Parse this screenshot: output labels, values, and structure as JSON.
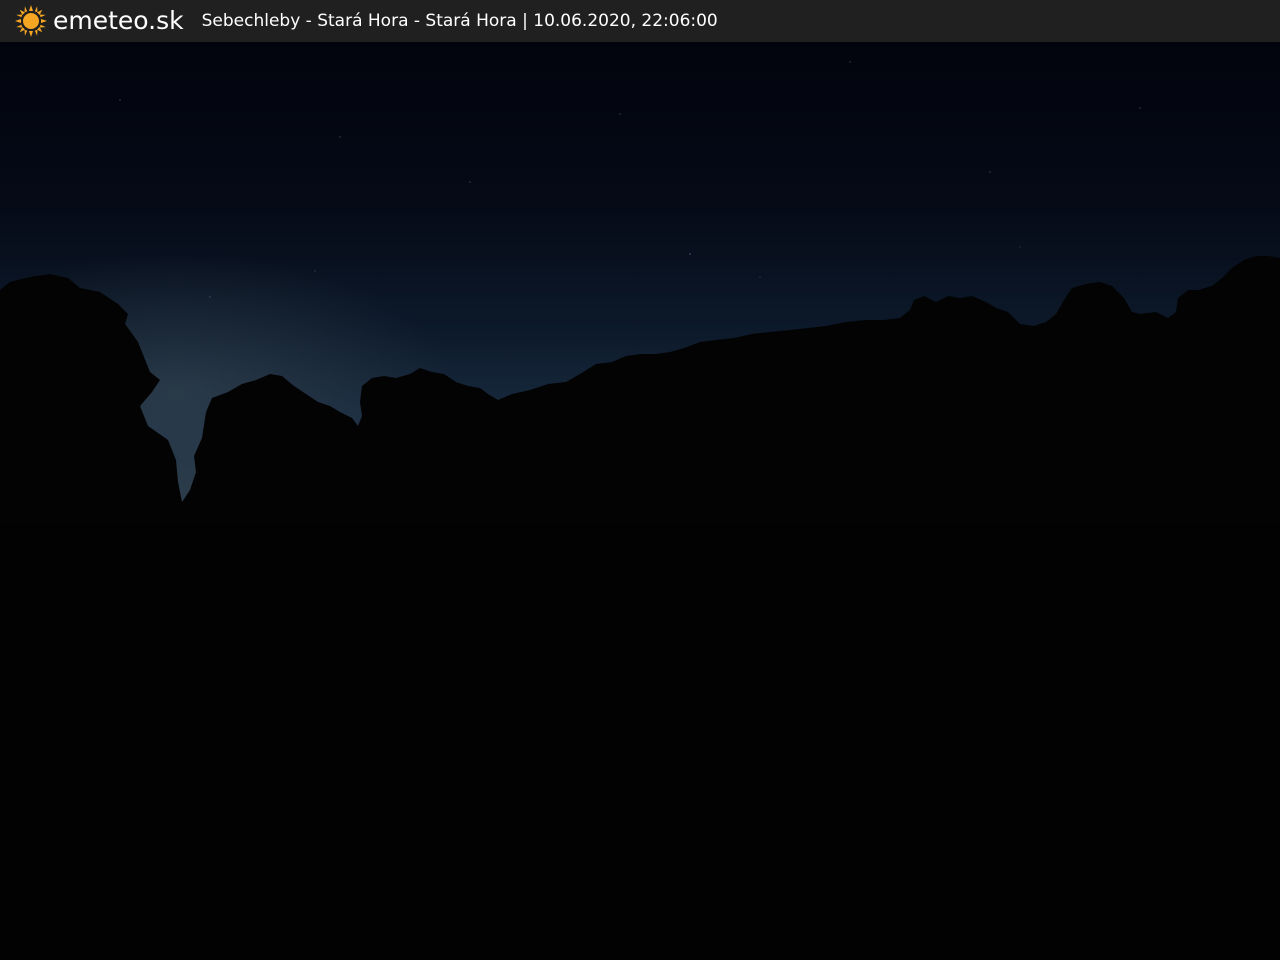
{
  "header": {
    "brand": "emeteo.sk",
    "location": "Sebechleby - Stará Hora - Stará Hora",
    "separator": "|",
    "timestamp": "10.06.2020, 22:06:00"
  },
  "icons": {
    "logo": "sun-icon"
  },
  "colors": {
    "header_bg": "#202020",
    "header_text": "#ffffff",
    "sun": "#f5a623",
    "sky_top": "#02040d",
    "sky_horizon": "#1a2d42",
    "ground": "#020202"
  }
}
